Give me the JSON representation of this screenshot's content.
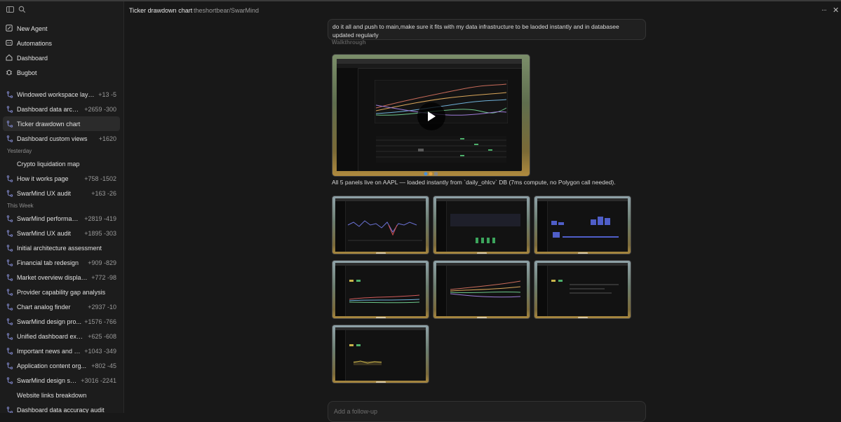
{
  "sidebar": {
    "nav": [
      {
        "label": "New Agent",
        "icon": "edit-icon"
      },
      {
        "label": "Automations",
        "icon": "automation-icon"
      },
      {
        "label": "Dashboard",
        "icon": "home-icon"
      },
      {
        "label": "Bugbot",
        "icon": "bug-icon"
      }
    ],
    "groups": {
      "yesterday": "Yesterday",
      "this_week": "This Week"
    },
    "threads": [
      {
        "title": "Windowed workspace layo...",
        "diff": "+13 -5",
        "icon": true
      },
      {
        "title": "Dashboard data archi...",
        "diff": "+2659 -300",
        "icon": true
      },
      {
        "title": "Ticker drawdown chart",
        "diff": "",
        "icon": true,
        "active": true
      },
      {
        "title": "Dashboard custom views",
        "diff": "+1620",
        "icon": true
      },
      {
        "group": "Yesterday"
      },
      {
        "title": "Crypto liquidation map",
        "diff": "",
        "icon": false
      },
      {
        "title": "How it works page",
        "diff": "+758 -1502",
        "icon": true
      },
      {
        "title": "SwarMind UX audit",
        "diff": "+163 -26",
        "icon": true
      },
      {
        "group": "This Week"
      },
      {
        "title": "SwarMind performanc...",
        "diff": "+2819 -419",
        "icon": true
      },
      {
        "title": "SwarMind UX audit",
        "diff": "+1895 -303",
        "icon": true
      },
      {
        "title": "Initial architecture assessment",
        "diff": "",
        "icon": true
      },
      {
        "title": "Financial tab redesign",
        "diff": "+909 -829",
        "icon": true
      },
      {
        "title": "Market overview display ...",
        "diff": "+772 -98",
        "icon": true
      },
      {
        "title": "Provider capability gap analysis",
        "diff": "",
        "icon": true
      },
      {
        "title": "Chart analog finder",
        "diff": "+2937 -10",
        "icon": true
      },
      {
        "title": "SwarMind design pro...",
        "diff": "+1576 -766",
        "icon": true
      },
      {
        "title": "Unified dashboard exp...",
        "diff": "+625 -608",
        "icon": true
      },
      {
        "title": "Important news and c...",
        "diff": "+1043 -349",
        "icon": true
      },
      {
        "title": "Application content org...",
        "diff": "+802 -45",
        "icon": true
      },
      {
        "title": "SwarMind design sys...",
        "diff": "+3016 -2241",
        "icon": true
      },
      {
        "title": "Website links breakdown",
        "diff": "",
        "icon": false
      },
      {
        "title": "Dashboard data accuracy audit",
        "diff": "",
        "icon": true
      }
    ]
  },
  "header": {
    "title": "Ticker drawdown chart",
    "repo": "theshortbear/SwarMind",
    "more": "···",
    "close": "✕"
  },
  "main": {
    "user_message": "do it all and push to main,make sure it fits with my data infrastructure to be laoded instantly and in databasee updated regularly",
    "section_label": "Walkthrough",
    "description": "All 5 panels live on AAPL — loaded instantly from `daily_ohlcv` DB (7ms compute, no Polygon call needed).",
    "followup_placeholder": "Add a follow-up"
  },
  "colors": {
    "background": "#181818",
    "sidebar": "#1c1c1c",
    "accent_icon": "#7f86c9"
  }
}
